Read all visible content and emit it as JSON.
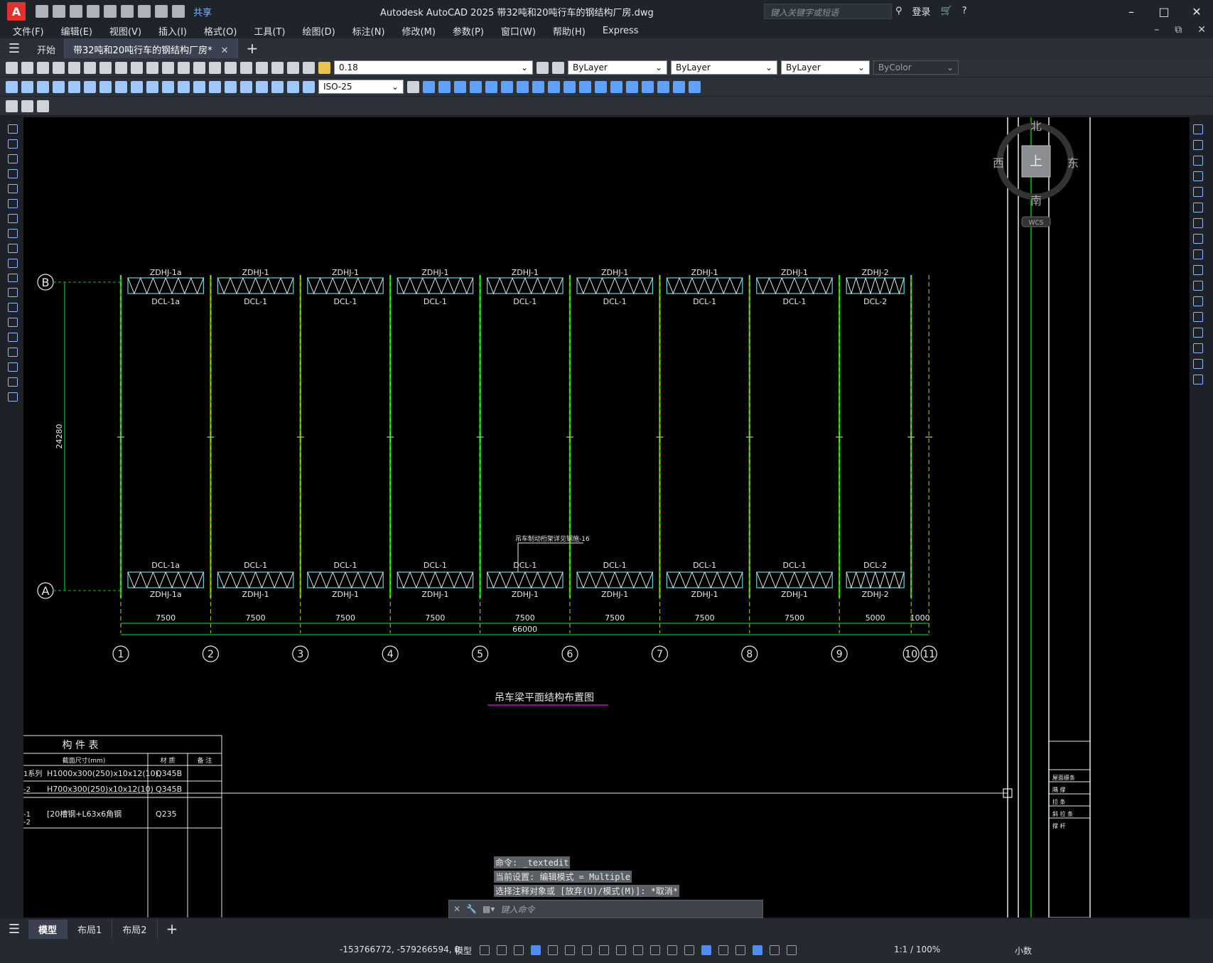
{
  "window": {
    "title": "Autodesk AutoCAD 2025    带32吨和20吨行车的钢结构厂房.dwg",
    "search_placeholder": "键入关键字或短语",
    "login": "登录",
    "share": "共享"
  },
  "menu": [
    "文件(F)",
    "编辑(E)",
    "视图(V)",
    "插入(I)",
    "格式(O)",
    "工具(T)",
    "绘图(D)",
    "标注(N)",
    "修改(M)",
    "参数(P)",
    "窗口(W)",
    "帮助(H)",
    "Express"
  ],
  "tabs": [
    {
      "label": "开始",
      "active": false
    },
    {
      "label": "带32吨和20吨行车的钢结构厂房*",
      "active": true
    }
  ],
  "properties": {
    "layer_value": "0.18",
    "color": "ByLayer",
    "linetype": "ByLayer",
    "lineweight": "ByLayer",
    "plotstyle": "ByColor",
    "dimstyle": "ISO-25"
  },
  "viewcube": {
    "north": "北",
    "south": "南",
    "east": "东",
    "west": "西",
    "top": "上",
    "wcs": "WCS"
  },
  "drawing": {
    "title": "吊车梁平面结构布置图",
    "rows": [
      "B",
      "A"
    ],
    "row_dim": "24280",
    "axes": [
      "1",
      "2",
      "3",
      "4",
      "5",
      "6",
      "7",
      "8",
      "9",
      "10",
      "11"
    ],
    "top_zdhj": [
      "ZDHJ-1a",
      "ZDHJ-1",
      "ZDHJ-1",
      "ZDHJ-1",
      "ZDHJ-1",
      "ZDHJ-1",
      "ZDHJ-1",
      "ZDHJ-1",
      "ZDHJ-2"
    ],
    "top_dcl": [
      "DCL-1a",
      "DCL-1",
      "DCL-1",
      "DCL-1",
      "DCL-1",
      "DCL-1",
      "DCL-1",
      "DCL-1",
      "DCL-2"
    ],
    "bot_dcl": [
      "DCL-1a",
      "DCL-1",
      "DCL-1",
      "DCL-1",
      "DCL-1",
      "DCL-1",
      "DCL-1",
      "DCL-1",
      "DCL-2"
    ],
    "bot_zdhj": [
      "ZDHJ-1a",
      "ZDHJ-1",
      "ZDHJ-1",
      "ZDHJ-1",
      "ZDHJ-1",
      "ZDHJ-1",
      "ZDHJ-1",
      "ZDHJ-1",
      "ZDHJ-2"
    ],
    "spans": [
      "7500",
      "7500",
      "7500",
      "7500",
      "7500",
      "7500",
      "7500",
      "7500",
      "5000",
      "1000"
    ],
    "total": "66000",
    "note": "吊车制动桁架详见钢施-16"
  },
  "parts_table": {
    "title": "构 件 表",
    "headers": [
      "截面尺寸(mm)",
      "材 质",
      "备 注"
    ],
    "rows": [
      {
        "id": "1系列",
        "section": "H1000x300(250)x10x12(10)",
        "material": "Q345B"
      },
      {
        "id": "-2",
        "section": "H700x300(250)x10x12(10)",
        "material": "Q345B"
      },
      {
        "id": "-1",
        "section": "[20槽钢+L63x6角钢",
        "material": "Q235"
      },
      {
        "id": "-2",
        "section": "",
        "material": ""
      }
    ]
  },
  "legend_right": [
    "屋面檩条",
    "隅 撑",
    "拉 条",
    "斜 拉 条",
    "撑 杆"
  ],
  "command": {
    "history": [
      "命令: _textedit",
      "当前设置: 编辑模式 = Multiple",
      "选择注释对象或 [放弃(U)/模式(M)]: *取消*"
    ],
    "placeholder": "键入命令"
  },
  "layouts": [
    "模型",
    "布局1",
    "布局2"
  ],
  "status": {
    "coords": "-153766772, -579266594, 0",
    "model": "模型",
    "scale": "1:1 / 100%",
    "units": "小数"
  }
}
